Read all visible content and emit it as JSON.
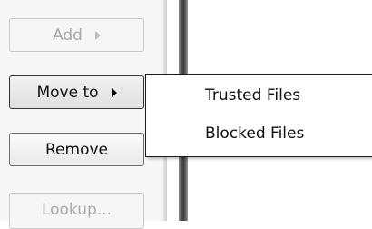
{
  "buttons": {
    "add": {
      "label": "Add",
      "state": "disabled"
    },
    "move_to": {
      "label": "Move to",
      "state": "active"
    },
    "remove": {
      "label": "Remove"
    },
    "lookup": {
      "label": "Lookup...",
      "state": "disabled"
    }
  },
  "submenu": {
    "items": [
      {
        "label": "Trusted Files"
      },
      {
        "label": "Blocked Files"
      }
    ]
  }
}
